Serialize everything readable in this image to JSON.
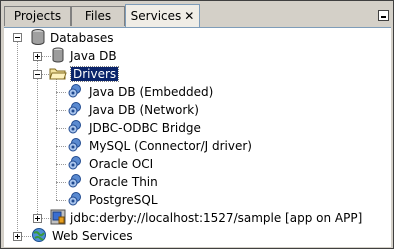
{
  "tabs": [
    {
      "label": "Projects"
    },
    {
      "label": "Files"
    },
    {
      "label": "Services",
      "close": "✕"
    }
  ],
  "tree": {
    "databases": "Databases",
    "javadb": "Java DB",
    "drivers": "Drivers",
    "driver_items": [
      {
        "label": "Java DB (Embedded)"
      },
      {
        "label": "Java DB (Network)"
      },
      {
        "label": "JDBC-ODBC Bridge"
      },
      {
        "label": "MySQL (Connector/J driver)"
      },
      {
        "label": "Oracle OCI"
      },
      {
        "label": "Oracle Thin"
      },
      {
        "label": "PostgreSQL"
      }
    ],
    "connection": "jdbc:derby://localhost:1527/sample [app on APP]",
    "web_services": "Web Services"
  },
  "colors": {
    "selection": "#0a246a",
    "panel": "#d4d0c8",
    "tree_bg": "#ffffff"
  }
}
